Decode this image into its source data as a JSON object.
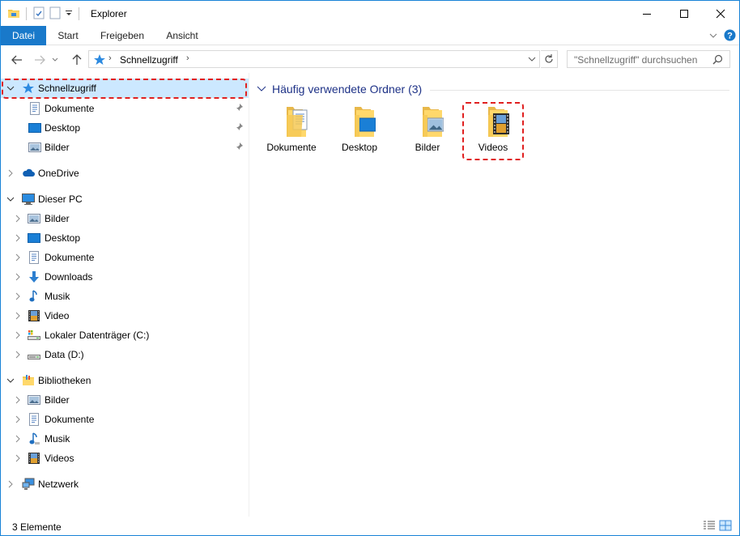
{
  "window": {
    "title": "Explorer",
    "accent": "#1979ca"
  },
  "ribbon": {
    "tabs": [
      {
        "label": "Datei"
      },
      {
        "label": "Start"
      },
      {
        "label": "Freigeben"
      },
      {
        "label": "Ansicht"
      }
    ]
  },
  "address": {
    "path": "Schnellzugriff",
    "chevron": "›"
  },
  "search": {
    "placeholder": "\"Schnellzugriff\" durchsuchen"
  },
  "nav": {
    "quick_access": {
      "label": "Schnellzugriff",
      "icon": "star-icon"
    },
    "quick_items": [
      {
        "label": "Dokumente",
        "icon": "documents-icon"
      },
      {
        "label": "Desktop",
        "icon": "desktop-icon"
      },
      {
        "label": "Bilder",
        "icon": "pictures-icon"
      }
    ],
    "onedrive": {
      "label": "OneDrive",
      "icon": "cloud-icon"
    },
    "this_pc": {
      "label": "Dieser PC",
      "icon": "computer-icon"
    },
    "pc_items": [
      {
        "label": "Bilder"
      },
      {
        "label": "Desktop"
      },
      {
        "label": "Dokumente"
      },
      {
        "label": "Downloads"
      },
      {
        "label": "Musik"
      },
      {
        "label": "Video"
      },
      {
        "label": "Lokaler Datenträger (C:)"
      },
      {
        "label": "Data (D:)"
      }
    ],
    "libraries": {
      "label": "Bibliotheken",
      "icon": "library-icon"
    },
    "lib_items": [
      {
        "label": "Bilder"
      },
      {
        "label": "Dokumente"
      },
      {
        "label": "Musik"
      },
      {
        "label": "Videos"
      }
    ],
    "network": {
      "label": "Netzwerk",
      "icon": "network-icon"
    }
  },
  "content": {
    "group_title": "Häufig verwendete Ordner (3)",
    "tiles": [
      {
        "label": "Dokumente"
      },
      {
        "label": "Desktop"
      },
      {
        "label": "Bilder"
      },
      {
        "label": "Videos"
      }
    ]
  },
  "status": {
    "items": "3 Elemente"
  }
}
